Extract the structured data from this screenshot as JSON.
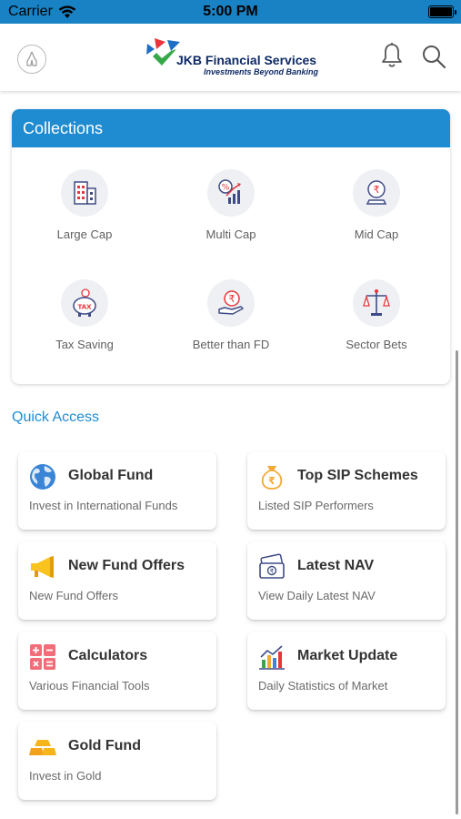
{
  "status_bar": {
    "carrier": "Carrier",
    "time": "5:00 PM"
  },
  "header": {
    "logo_title": "JKB Financial Services",
    "logo_subtitle": "Investments Beyond Banking"
  },
  "collections": {
    "title": "Collections",
    "items": [
      {
        "label": "Large Cap",
        "icon": "building-icon"
      },
      {
        "label": "Multi Cap",
        "icon": "percent-growth-icon"
      },
      {
        "label": "Mid Cap",
        "icon": "rupee-coin-stand-icon"
      },
      {
        "label": "Tax Saving",
        "icon": "tax-piggy-bank-icon"
      },
      {
        "label": "Better than FD",
        "icon": "rupee-hand-icon"
      },
      {
        "label": "Sector Bets",
        "icon": "balance-scale-icon"
      }
    ]
  },
  "quick_access": {
    "title": "Quick Access",
    "cards": [
      {
        "title": "Global Fund",
        "subtitle": "Invest in International Funds",
        "icon": "globe-icon"
      },
      {
        "title": "Top SIP Schemes",
        "subtitle": "Listed SIP Performers",
        "icon": "money-bag-icon"
      },
      {
        "title": "New Fund Offers",
        "subtitle": "New Fund Offers",
        "icon": "megaphone-icon"
      },
      {
        "title": "Latest NAV",
        "subtitle": "View Daily Latest NAV",
        "icon": "banknote-icon"
      },
      {
        "title": "Calculators",
        "subtitle": "Various Financial Tools",
        "icon": "calculator-icon"
      },
      {
        "title": "Market Update",
        "subtitle": "Daily Statistics of Market",
        "icon": "market-chart-icon"
      },
      {
        "title": "Gold Fund",
        "subtitle": "Invest in Gold",
        "icon": "gold-bars-icon"
      }
    ]
  },
  "colors": {
    "primary": "#1f8cd1",
    "status_bar": "#1882c4",
    "logo_text": "#0f2a66"
  }
}
